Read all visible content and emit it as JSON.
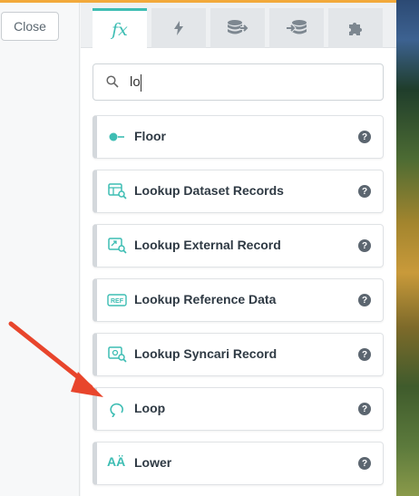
{
  "left": {
    "close_label": "Close"
  },
  "tabs": [
    {
      "icon": "fx-icon",
      "label": "fx",
      "active": true
    },
    {
      "icon": "bolt-icon",
      "active": false
    },
    {
      "icon": "database-export-icon",
      "active": false
    },
    {
      "icon": "database-import-icon",
      "active": false
    },
    {
      "icon": "puzzle-icon",
      "active": false
    }
  ],
  "search": {
    "value": "lo"
  },
  "items": [
    {
      "label": "Floor",
      "icon": "floor-icon",
      "help": "?"
    },
    {
      "label": "Lookup Dataset Records",
      "icon": "dataset-lookup-icon",
      "help": "?"
    },
    {
      "label": "Lookup External Record",
      "icon": "external-lookup-icon",
      "help": "?"
    },
    {
      "label": "Lookup Reference Data",
      "icon": "ref-icon",
      "ref_text": "REF",
      "help": "?"
    },
    {
      "label": "Lookup Syncari Record",
      "icon": "syncari-lookup-icon",
      "help": "?"
    },
    {
      "label": "Loop",
      "icon": "loop-icon",
      "help": "?"
    },
    {
      "label": "Lower",
      "icon": "lowercase-icon",
      "lower_text": "AÄ",
      "help": "?"
    }
  ],
  "colors": {
    "accent": "#3dbdb3",
    "arrow": "#e8452c",
    "top_bar": "#f2a93b"
  }
}
